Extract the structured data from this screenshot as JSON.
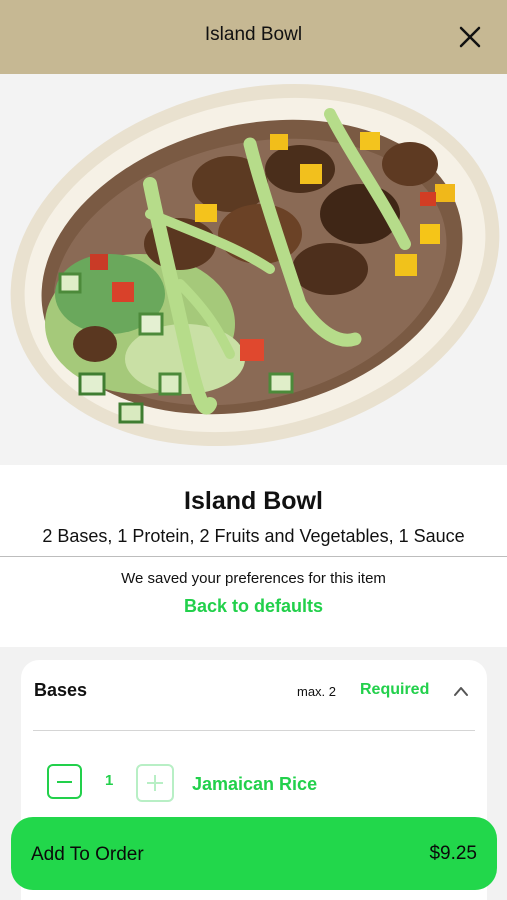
{
  "header": {
    "title": "Island Bowl",
    "close_icon": "close-icon"
  },
  "hero": {
    "image": "island-bowl-photo"
  },
  "item": {
    "name": "Island Bowl",
    "description": "2 Bases, 1 Protein, 2 Fruits and Vegetables, 1 Sauce"
  },
  "preferences": {
    "note": "We saved your preferences for this item",
    "reset_label": "Back to defaults"
  },
  "sections": {
    "bases": {
      "title": "Bases",
      "max_label": "max. 2",
      "required_label": "Required",
      "toggle_icon": "chevron-up-icon",
      "options": [
        {
          "label": "Jamaican Rice",
          "quantity": "1"
        }
      ]
    }
  },
  "footer": {
    "add_label": "Add To Order",
    "price": "$9.25"
  },
  "colors": {
    "header_bg": "#c6b893",
    "accent_green": "#22d04b",
    "button_green": "#22d74b"
  }
}
